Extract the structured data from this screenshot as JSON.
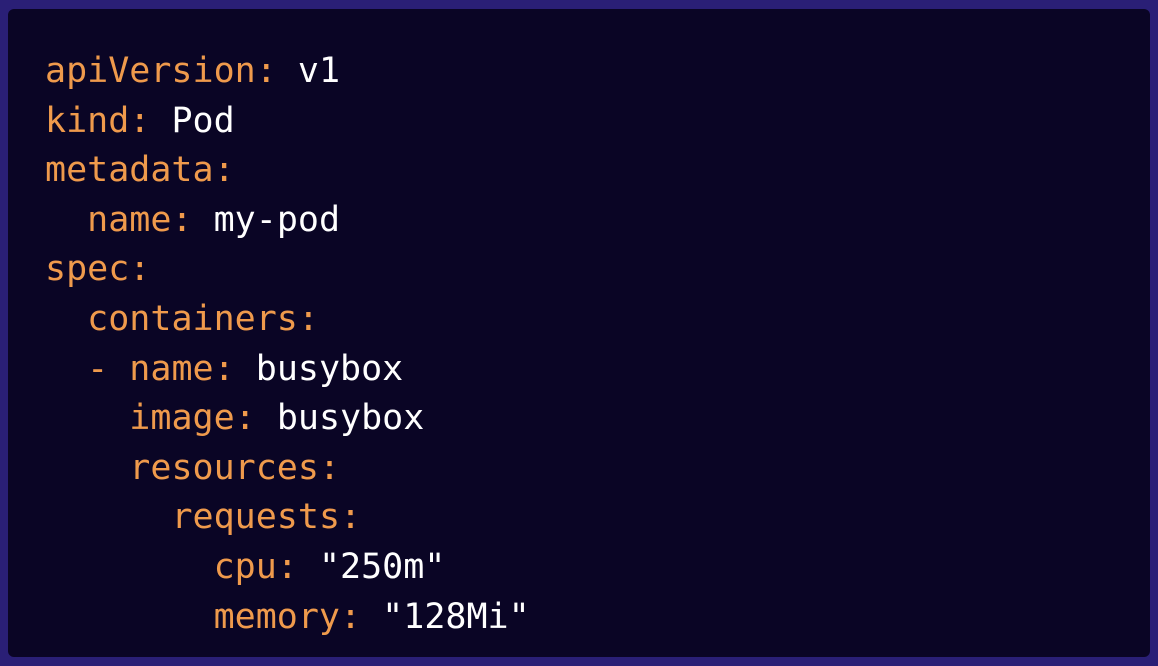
{
  "colors": {
    "outer_background": "#2a1f76",
    "code_background": "#0a0525",
    "key_color": "#ef9a4c",
    "value_color": "#ffffff"
  },
  "code_lines": [
    {
      "indent": "",
      "key": "apiVersion",
      "sep": ": ",
      "value": "v1"
    },
    {
      "indent": "",
      "key": "kind",
      "sep": ": ",
      "value": "Pod"
    },
    {
      "indent": "",
      "key": "metadata",
      "sep": ":",
      "value": ""
    },
    {
      "indent": "  ",
      "key": "name",
      "sep": ": ",
      "value": "my-pod"
    },
    {
      "indent": "",
      "key": "spec",
      "sep": ":",
      "value": ""
    },
    {
      "indent": "  ",
      "key": "containers",
      "sep": ":",
      "value": ""
    },
    {
      "indent": "  - ",
      "key": "name",
      "sep": ": ",
      "value": "busybox"
    },
    {
      "indent": "    ",
      "key": "image",
      "sep": ": ",
      "value": "busybox"
    },
    {
      "indent": "    ",
      "key": "resources",
      "sep": ":",
      "value": ""
    },
    {
      "indent": "      ",
      "key": "requests",
      "sep": ":",
      "value": ""
    },
    {
      "indent": "        ",
      "key": "cpu",
      "sep": ": ",
      "value": "\"250m\""
    },
    {
      "indent": "        ",
      "key": "memory",
      "sep": ": ",
      "value": "\"128Mi\""
    }
  ]
}
